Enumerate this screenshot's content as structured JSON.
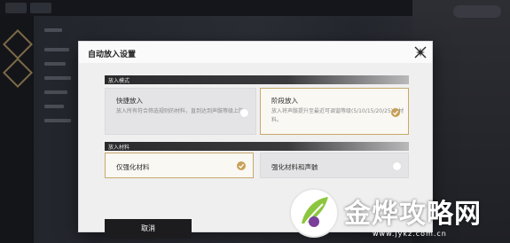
{
  "modal": {
    "title": "自动放入设置",
    "sections": {
      "mode_label": "放入模式",
      "material_label": "放入材料"
    },
    "mode_options": [
      {
        "title": "快捷放入",
        "desc": "放入所有符合筛选规则的材料，直到达到声骸等级上限。",
        "selected": false
      },
      {
        "title": "阶段放入",
        "desc": "放入将声骸提升至最近可调谐等级(5/10/15/20/25)的材料。",
        "selected": true
      }
    ],
    "material_options": [
      {
        "title": "仅强化材料",
        "selected": true
      },
      {
        "title": "强化材料和声骸",
        "selected": false
      }
    ],
    "cancel_label": "取消"
  },
  "colors": {
    "accent": "#c8a057",
    "dark": "#1c1c1e"
  },
  "watermark": {
    "text": "金烨攻略网",
    "url": "www.jykz.com.cn"
  }
}
